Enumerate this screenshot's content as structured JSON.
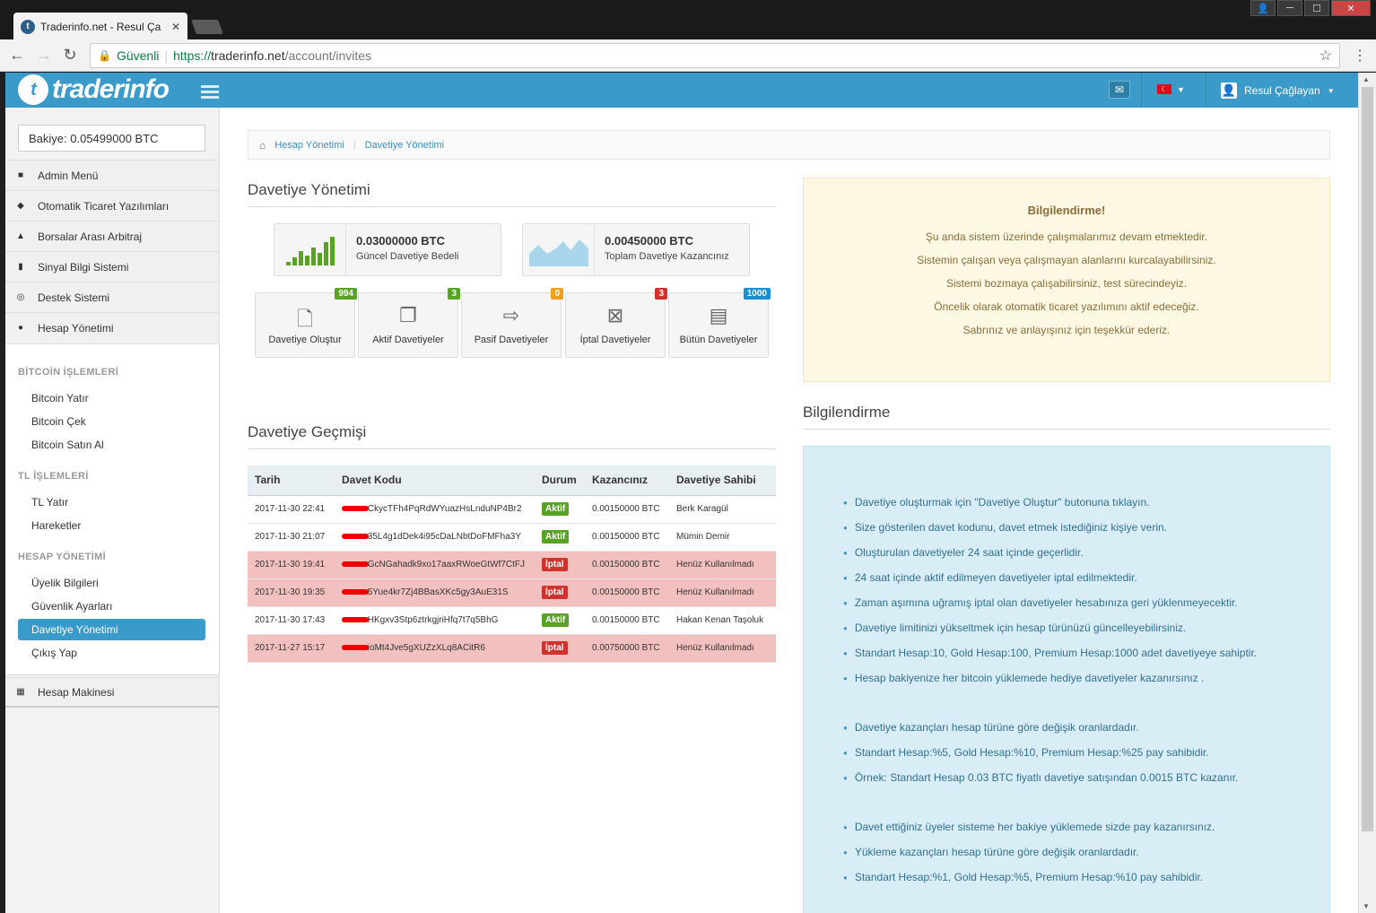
{
  "browser": {
    "tab_title": "Traderinfo.net - Resul Ça",
    "secure_label": "Güvenli",
    "url_scheme": "https://",
    "url_host": "traderinfo.net",
    "url_path": "/account/invites"
  },
  "header": {
    "logo_text": "traderinfo",
    "user_name": "Resul Çağlayan"
  },
  "sidebar": {
    "balance": "Bakiye: 0.05499000 BTC",
    "top_items": [
      {
        "label": "Admin Menü",
        "icon": "lock-icon"
      },
      {
        "label": "Otomatik Ticaret Yazılımları",
        "icon": "android-icon"
      },
      {
        "label": "Borsalar Arası Arbitraj",
        "icon": "area-chart-icon"
      },
      {
        "label": "Sinyal Bilgi Sistemi",
        "icon": "signal-icon"
      },
      {
        "label": "Destek Sistemi",
        "icon": "lifebuoy-icon"
      },
      {
        "label": "Hesap Yönetimi",
        "icon": "user-icon"
      }
    ],
    "sections": [
      {
        "title": "BİTCOİN İŞLEMLERİ",
        "items": [
          "Bitcoin Yatır",
          "Bitcoin Çek",
          "Bitcoin Satın Al"
        ]
      },
      {
        "title": "TL İŞLEMLERİ",
        "items": [
          "TL Yatır",
          "Hareketler"
        ]
      },
      {
        "title": "HESAP YÖNETİMİ",
        "items": [
          "Üyelik Bilgileri",
          "Güvenlik Ayarları",
          "Davetiye Yönetimi",
          "Çıkış Yap"
        ]
      }
    ],
    "bottom_item": {
      "label": "Hesap Makinesi",
      "icon": "calculator-icon"
    }
  },
  "breadcrumb": [
    "Hesap Yönetimi",
    "Davetiye Yönetimi"
  ],
  "main": {
    "title": "Davetiye Yönetimi",
    "stats": [
      {
        "value": "0.03000000 BTC",
        "label": "Güncel Davetiye Bedeli"
      },
      {
        "value": "0.00450000 BTC",
        "label": "Toplam Davetiye Kazancınız"
      }
    ],
    "tiles": [
      {
        "label": "Davetiye Oluştur",
        "badge": "994",
        "color": "#58a324",
        "icon": "file-plus-icon"
      },
      {
        "label": "Aktif Davetiyeler",
        "badge": "3",
        "color": "#58a324",
        "icon": "files-icon"
      },
      {
        "label": "Pasif Davetiyeler",
        "badge": "0",
        "color": "#f0a020",
        "icon": "file-export-icon"
      },
      {
        "label": "İptal Davetiyeler",
        "badge": "3",
        "color": "#d2322d",
        "icon": "file-remove-icon"
      },
      {
        "label": "Bütün Davetiyeler",
        "badge": "1000",
        "color": "#1a8fd0",
        "icon": "id-card-icon"
      }
    ],
    "history_title": "Davetiye Geçmişi",
    "table": {
      "headers": [
        "Tarih",
        "Davet Kodu",
        "Durum",
        "Kazancınız",
        "Davetiye Sahibi"
      ],
      "rows": [
        {
          "date": "2017-11-30 22:41",
          "code": "CkycTFh4PqRdWYuazHsLnduNP4Br2",
          "status": "Aktif",
          "earn": "0.00150000 BTC",
          "owner": "Berk Karagül"
        },
        {
          "date": "2017-11-30 21:07",
          "code": "35L4g1dDek4i95cDaLNbtDoFMFha3Y",
          "status": "Aktif",
          "earn": "0.00150000 BTC",
          "owner": "Mümin Demir"
        },
        {
          "date": "2017-11-30 19:41",
          "code": "GcNGahadk9xo17aaxRWoeGtWf7CtFJ",
          "status": "İptal",
          "earn": "0.00150000 BTC",
          "owner": "Henüz Kullanılmadı"
        },
        {
          "date": "2017-11-30 19:35",
          "code": "5Yue4kr7Zj4BBasXKc5gy3AuE31S",
          "status": "İptal",
          "earn": "0.00150000 BTC",
          "owner": "Henüz Kullanılmadı"
        },
        {
          "date": "2017-11-30 17:43",
          "code": "HKgxv3Stp6ztrkgjriHfq7t7q5BhG",
          "status": "Aktif",
          "earn": "0.00150000 BTC",
          "owner": "Hakan Kenan Taşoluk"
        },
        {
          "date": "2017-11-27 15:17",
          "code": "ioMt4Jve5gXUZzXLq8ACitR6",
          "status": "İptal",
          "earn": "0.00750000 BTC",
          "owner": "Henüz Kullanılmadı"
        }
      ]
    }
  },
  "notice": {
    "title": "Bilgilendirme!",
    "lines": [
      "Şu anda sistem üzerinde çalışmalarımız devam etmektedir.",
      "Sistemin çalışan veya çalışmayan alanlarını kurcalayabilirsiniz.",
      "Sistemi bozmaya çalışabilirsiniz, test sürecindeyiz.",
      "Öncelik olarak otomatik ticaret yazılımını aktif edeceğiz.",
      "Sabrınız ve anlayışınız için teşekkür ederiz."
    ]
  },
  "info": {
    "title": "Bilgilendirme",
    "groups": [
      [
        "Davetiye oluşturmak için \"Davetiye Oluştur\" butonuna tıklayın.",
        "Size gösterilen davet kodunu, davet etmek istediğiniz kişiye verin.",
        "Oluşturulan davetiyeler 24 saat içinde geçerlidir.",
        "24 saat içinde aktif edilmeyen davetiyeler iptal edilmektedir.",
        "Zaman aşımına uğramış iptal olan davetiyeler hesabınıza geri yüklenmeyecektir.",
        "Davetiye limitinizi yükseltmek için hesap türünüzü güncelleyebilirsiniz.",
        "Standart Hesap:10, Gold Hesap:100, Premium Hesap:1000 adet davetiyeye sahiptir.",
        "Hesap bakiyenize her bitcoin yüklemede hediye davetiyeler kazanırsınız ."
      ],
      [
        "Davetiye kazançları hesap türüne göre değişik oranlardadır.",
        "Standart Hesap:%5, Gold Hesap:%10, Premium Hesap:%25 pay sahibidir.",
        "Örnek: Standart Hesap 0.03 BTC fiyatlı davetiye satışından 0.0015 BTC kazanır."
      ],
      [
        "Davet ettiğiniz üyeler sisteme her bakiye yüklemede sizde pay kazanırsınız.",
        "Yükleme kazançları hesap türüne göre değişik oranlardadır.",
        "Standart Hesap:%1, Gold Hesap:%5, Premium Hesap:%10 pay sahibidir."
      ]
    ]
  },
  "colors": {
    "brand": "#3a9ac9",
    "active": "#58a324",
    "cancel": "#d2322d"
  }
}
